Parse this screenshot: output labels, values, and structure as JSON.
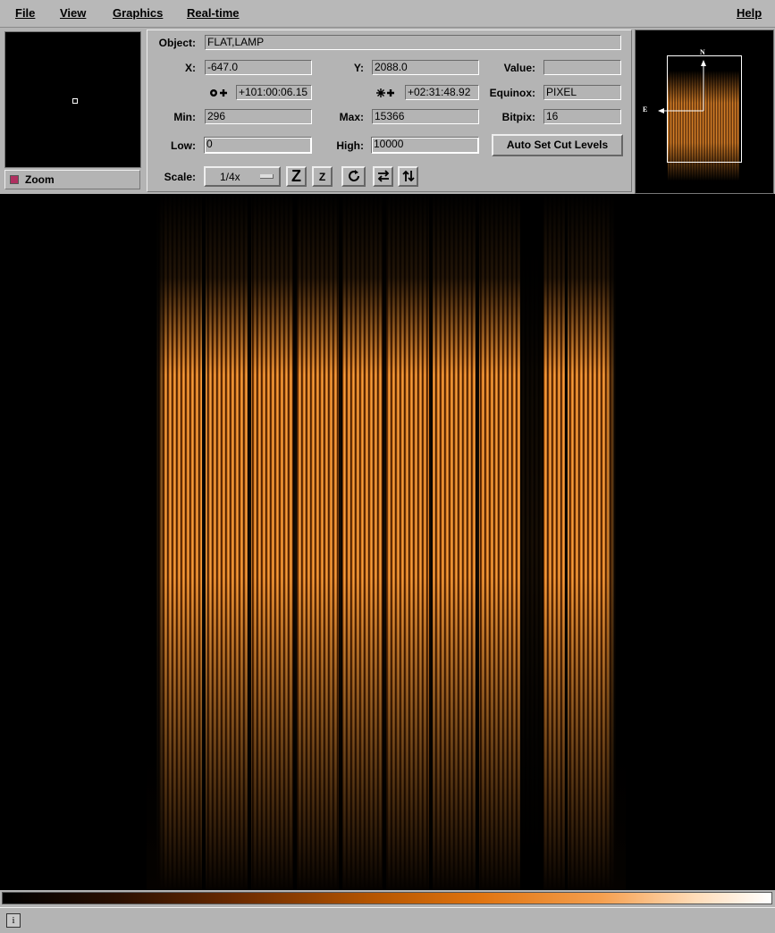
{
  "menubar": {
    "file": "File",
    "view": "View",
    "graphics": "Graphics",
    "realtime": "Real-time",
    "help": "Help"
  },
  "zoom": {
    "label": "Zoom"
  },
  "info": {
    "object_label": "Object:",
    "object_value": "FLAT,LAMP",
    "x_label": "X:",
    "x_value": "-647.0",
    "y_label": "Y:",
    "y_value": "2088.0",
    "value_label": "Value:",
    "value_value": "",
    "ra_value": "+101:00:06.15",
    "dec_value": "+02:31:48.92",
    "equinox_label": "Equinox:",
    "equinox_value": "PIXEL",
    "min_label": "Min:",
    "min_value": "296",
    "max_label": "Max:",
    "max_value": "15366",
    "bitpix_label": "Bitpix:",
    "bitpix_value": "16",
    "low_label": "Low:",
    "low_value": "0",
    "high_label": "High:",
    "high_value": "10000",
    "auto_cut_label": "Auto Set Cut Levels",
    "scale_label": "Scale:",
    "scale_value": "1/4x"
  },
  "panner": {
    "north": "N",
    "east": "E"
  },
  "colors": {
    "accent": "#f08a20",
    "background": "#b4b4b4"
  }
}
